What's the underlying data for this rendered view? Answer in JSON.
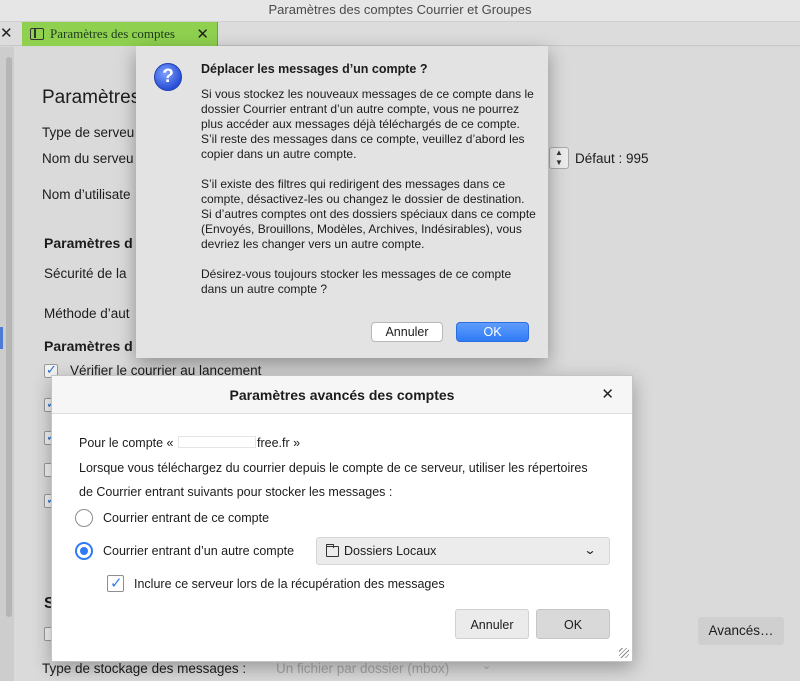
{
  "window": {
    "title": "Paramètres des comptes Courrier et Groupes"
  },
  "tab": {
    "label": "Paramètres des comptes",
    "close": "✕"
  },
  "background": {
    "title": "Paramètres",
    "server_type_label": "Type de serveu",
    "server_name_label": "Nom du serveu",
    "default_port": "Défaut : 995",
    "username_label": "Nom d’utilisate",
    "security_heading": "Paramètres d",
    "security_label": "Sécurité de la",
    "auth_label": "Méthode d’aut",
    "server_settings_heading": "Paramètres d",
    "check_mail": "Vérifier le courrier au lancement",
    "storage_heading": "S",
    "advanced_button": "Avancés…",
    "storage_type_label": "Type de stockage des messages :",
    "storage_type_value": "Un fichier par dossier (mbox)"
  },
  "alert": {
    "title": "Déplacer les messages d’un compte ?",
    "body": "Si vous stockez les nouveaux messages de ce compte dans le dossier Courrier entrant d’un autre compte, vous ne pourrez plus accéder aux messages déjà téléchargés de ce compte. S’il reste des messages dans ce compte, veuillez d’abord les copier dans un autre compte.\n\nS’il existe des filtres qui redirigent des messages dans ce compte, désactivez-les ou changez le dossier de destination. Si d’autres comptes ont des dossiers spéciaux dans ce compte (Envoyés, Brouillons, Modèles, Archives, Indésirables), vous devriez les changer vers un autre compte.\n\nDésirez-vous toujours stocker les messages de ce compte dans un autre compte ?",
    "cancel_label": "Annuler",
    "ok_label": "OK"
  },
  "advanced": {
    "title": "Paramètres avancés des comptes",
    "account_prefix": "Pour le compte «",
    "account_suffix": "free.fr »",
    "description_line1": "Lorsque vous téléchargez du courrier depuis le compte de ce serveur, utiliser les répertoires",
    "description_line2": "de Courrier entrant suivants pour stocker les messages :",
    "option_this_account": "Courrier entrant de ce compte",
    "option_other_account": "Courrier entrant d’un autre compte",
    "selected_folder": "Dossiers Locaux",
    "include_server_label": "Inclure ce serveur lors de la récupération des messages",
    "cancel_label": "Annuler",
    "ok_label": "OK"
  }
}
